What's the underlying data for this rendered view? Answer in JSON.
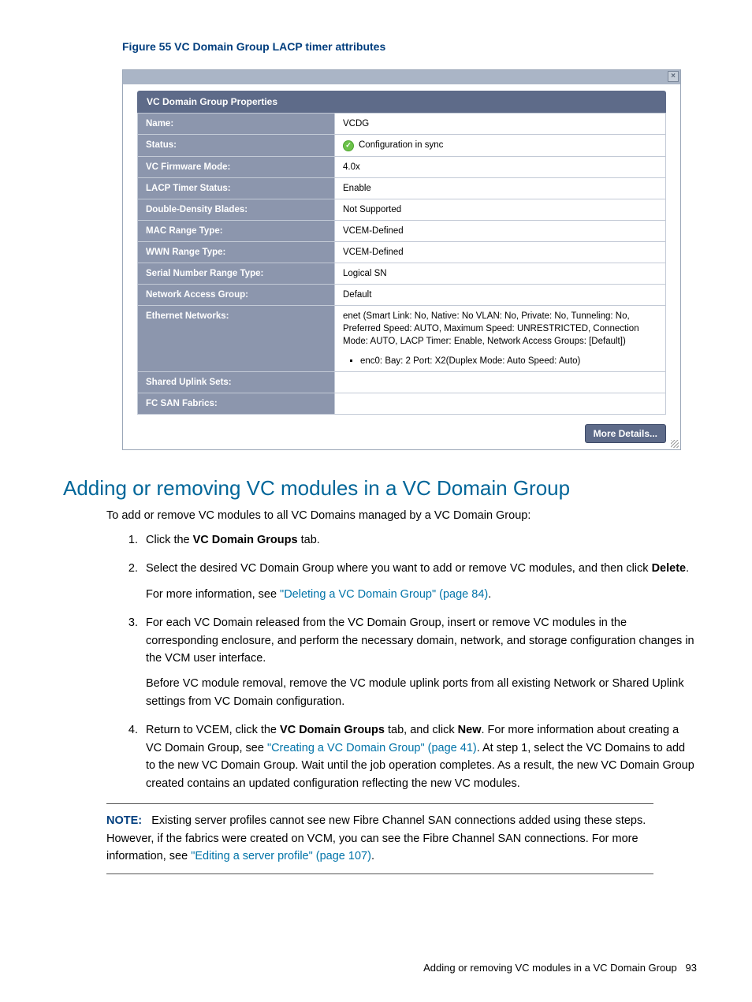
{
  "figure_caption": "Figure 55 VC Domain Group LACP timer attributes",
  "panel": {
    "title": "VC Domain Group Properties",
    "rows": [
      {
        "key": "Name:",
        "val": "VCDG"
      },
      {
        "key": "Status:",
        "val": "Configuration in sync",
        "status_icon": true
      },
      {
        "key": "VC Firmware Mode:",
        "val": "4.0x"
      },
      {
        "key": "LACP Timer Status:",
        "val": "Enable"
      },
      {
        "key": "Double-Density Blades:",
        "val": "Not Supported"
      },
      {
        "key": "MAC Range Type:",
        "val": "VCEM-Defined"
      },
      {
        "key": "WWN Range Type:",
        "val": "VCEM-Defined"
      },
      {
        "key": "Serial Number Range Type:",
        "val": "Logical SN"
      },
      {
        "key": "Network Access Group:",
        "val": "Default"
      },
      {
        "key": "Ethernet Networks:",
        "val": "enet (Smart Link: No, Native: No VLAN: No, Private: No, Tunneling: No, Preferred Speed: AUTO, Maximum Speed: UNRESTRICTED, Connection Mode: AUTO, LACP Timer: Enable, Network Access Groups: [Default])",
        "bullets": [
          "enc0: Bay: 2 Port: X2(Duplex Mode: Auto Speed: Auto)"
        ]
      },
      {
        "key": "Shared Uplink Sets:",
        "val": ""
      },
      {
        "key": "FC SAN Fabrics:",
        "val": ""
      }
    ],
    "more_details": "More Details..."
  },
  "section_title": "Adding or removing VC modules in a VC Domain Group",
  "intro": "To add or remove VC modules to all VC Domains managed by a VC Domain Group:",
  "steps": {
    "s1_a": "Click the ",
    "s1_b": "VC Domain Groups",
    "s1_c": " tab.",
    "s2_a": "Select the desired VC Domain Group where you want to add or remove VC modules, and then click ",
    "s2_b": "Delete",
    "s2_c": ".",
    "s2_more": "For more information, see ",
    "s2_link": "\"Deleting a VC Domain Group\" (page 84)",
    "s2_end": ".",
    "s3_a": "For each VC Domain released from the VC Domain Group, insert or remove VC modules in the corresponding enclosure, and perform the necessary domain, network, and storage configuration changes in the VCM user interface.",
    "s3_b": "Before VC module removal, remove the VC module uplink ports from all existing Network or Shared Uplink settings from VC Domain configuration.",
    "s4_a": "Return to VCEM, click the ",
    "s4_b": "VC Domain Groups",
    "s4_c": " tab, and click ",
    "s4_d": "New",
    "s4_e": ". For more information about creating a VC Domain Group, see ",
    "s4_link": "\"Creating a VC Domain Group\" (page 41)",
    "s4_f": ". At step 1, select the VC Domains to add to the new VC Domain Group. Wait until the job operation completes. As a result, the new VC Domain Group created contains an updated configuration reflecting the new VC modules."
  },
  "note": {
    "label": "NOTE:",
    "text_a": "Existing server profiles cannot see new Fibre Channel SAN connections added using these steps. However, if the fabrics were created on VCM, you can see the Fibre Channel SAN connections. For more information, see ",
    "link": "\"Editing a server profile\" (page 107)",
    "text_b": "."
  },
  "footer": {
    "text": "Adding or removing VC modules in a VC Domain Group",
    "page": "93"
  }
}
